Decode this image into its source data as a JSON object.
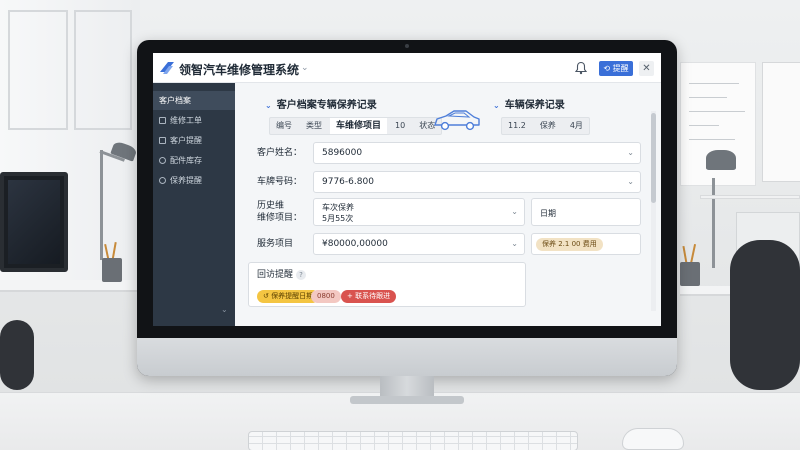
{
  "app": {
    "title": "领智汽车维修管理系统",
    "primary_button": "提醒",
    "close_glyph": "✕",
    "title_chevron": "⌄"
  },
  "sidebar": {
    "items": [
      {
        "label": "客户档案",
        "active": true
      },
      {
        "label": "维修工单"
      },
      {
        "label": "客户提醒"
      },
      {
        "label": "配件库存"
      },
      {
        "label": "保养提醒"
      }
    ],
    "collapse_glyph": "⌄"
  },
  "sections": {
    "left_title": "客户档案专辆保养记录",
    "right_title": "车辆保养记录",
    "chevron": "⌄"
  },
  "tabs_left": [
    {
      "label": "编号"
    },
    {
      "label": "类型"
    },
    {
      "label": "车维修项目",
      "active": true
    },
    {
      "label": "10"
    },
    {
      "label": "状态"
    }
  ],
  "tabs_right": [
    {
      "label": "11.2"
    },
    {
      "label": "保养"
    },
    {
      "label": "4月"
    }
  ],
  "form": {
    "customer_name_label": "客户姓名：",
    "customer_name_value": "5896000",
    "plate_label": "车牌号码：",
    "plate_value": "9776-6.800",
    "history_label_1": "历史维",
    "history_label_2": "维修项目：",
    "history_value_1": "车次保养",
    "history_value_2": "5月55次",
    "service_label": "服务项目",
    "service_value": "¥80000,00000",
    "reminder_label": "回访提醒",
    "reminder_help": "?"
  },
  "right_panel": {
    "box1_label": "日期",
    "box2_pill": "保养 2.1 00 费用"
  },
  "reminder_pills": [
    {
      "label": "↺ 保养提醒日期",
      "color": "#f4c542",
      "text": "#5b4100"
    },
    {
      "label": "0800",
      "color": "#f3c8c2",
      "text": "#8a3b2f"
    },
    {
      "label": "+ 联系待跟进",
      "color": "#d9534f",
      "text": "#ffffff"
    }
  ],
  "colors": {
    "accent": "#3a6fd8",
    "sidebar": "#2d3845"
  }
}
